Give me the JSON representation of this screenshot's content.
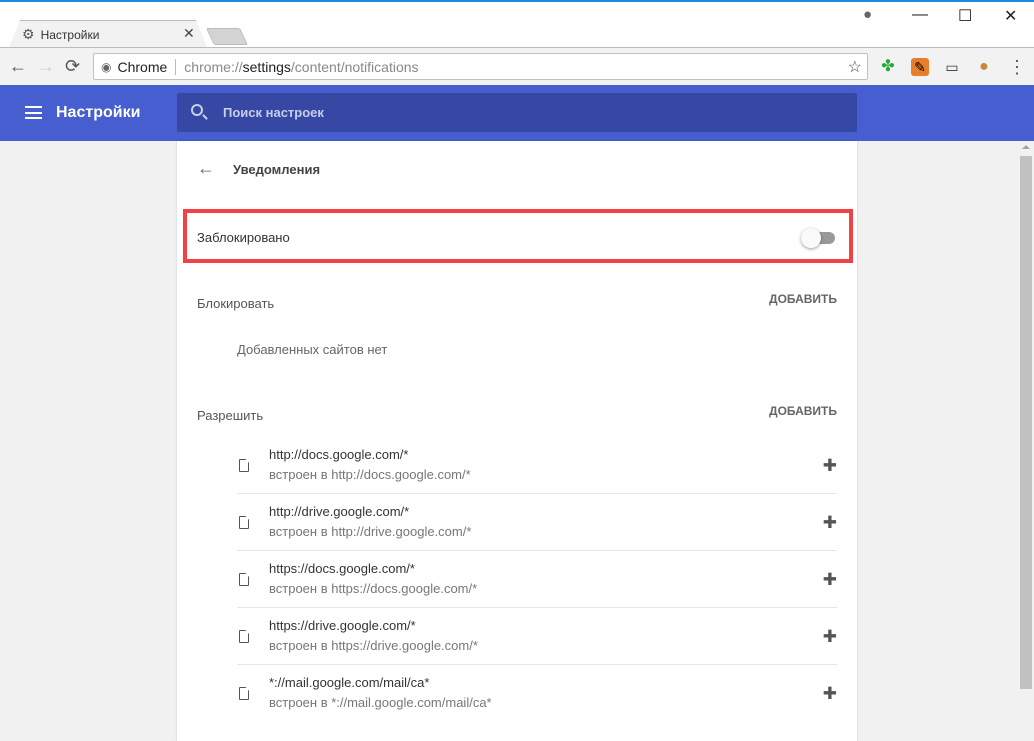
{
  "tab": {
    "title": "Настройки",
    "close": "✕"
  },
  "window": {
    "minimize": "—",
    "maximize": "☐",
    "close": "✕"
  },
  "toolbar": {
    "back": "←",
    "forward": "→",
    "reload": "⟳",
    "site_label": "Chrome",
    "url_prefix": "chrome://",
    "url_host": "settings",
    "url_path": "/content/notifications",
    "star": "☆",
    "menu": "⋮"
  },
  "header": {
    "title": "Настройки",
    "search_placeholder": "Поиск настроек"
  },
  "page": {
    "back": "←",
    "title": "Уведомления",
    "blocked_label": "Заблокировано",
    "toggle_on": false
  },
  "block": {
    "label": "Блокировать",
    "add": "ДОБАВИТЬ",
    "empty": "Добавленных сайтов нет"
  },
  "allow": {
    "label": "Разрешить",
    "add": "ДОБАВИТЬ",
    "items": [
      {
        "title": "http://docs.google.com/*",
        "sub": "встроен в http://docs.google.com/*"
      },
      {
        "title": "http://drive.google.com/*",
        "sub": "встроен в http://drive.google.com/*"
      },
      {
        "title": "https://docs.google.com/*",
        "sub": "встроен в https://docs.google.com/*"
      },
      {
        "title": "https://drive.google.com/*",
        "sub": "встроен в https://drive.google.com/*"
      },
      {
        "title": "*://mail.google.com/mail/ca*",
        "sub": "встроен в *://mail.google.com/mail/ca*"
      }
    ]
  },
  "colors": {
    "header": "#465ed0",
    "search": "#3648a4",
    "highlight": "#f44146"
  }
}
